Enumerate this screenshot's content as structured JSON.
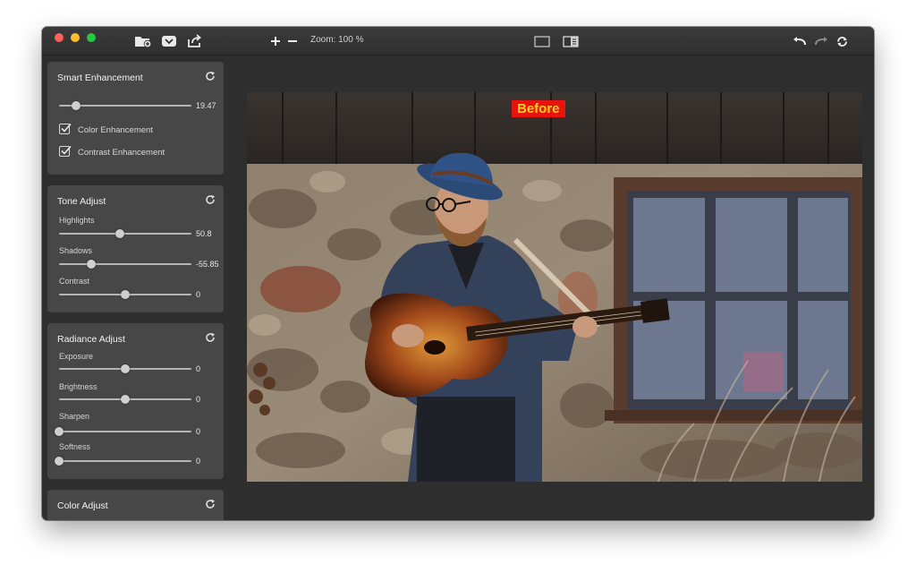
{
  "toolbar": {
    "zoom_label": "Zoom: 100 %",
    "icons": [
      "add-folder-icon",
      "import-icon",
      "export-icon",
      "zoom-in-icon",
      "zoom-out-icon",
      "single-view-icon",
      "split-view-icon",
      "undo-icon",
      "redo-icon",
      "refresh-icon"
    ]
  },
  "panels": {
    "smart": {
      "title": "Smart Enhancement",
      "value": "19.47",
      "level": 0.13,
      "checks": [
        {
          "label": "Color Enhancement",
          "checked": true
        },
        {
          "label": "Contrast Enhancement",
          "checked": true
        }
      ]
    },
    "tone": {
      "title": "Tone Adjust",
      "sliders": [
        {
          "label": "Highlights",
          "value": "50.8",
          "level": 0.46
        },
        {
          "label": "Shadows",
          "value": "-55.85",
          "level": 0.24
        },
        {
          "label": "Contrast",
          "value": "0",
          "level": 0.5
        }
      ]
    },
    "radiance": {
      "title": "Radiance Adjust",
      "sliders": [
        {
          "label": "Exposure",
          "value": "0",
          "level": 0.5
        },
        {
          "label": "Brightness",
          "value": "0",
          "level": 0.5
        },
        {
          "label": "Sharpen",
          "value": "0",
          "level": 0.0
        },
        {
          "label": "Softness",
          "value": "0",
          "level": 0.0
        }
      ]
    },
    "color": {
      "title": "Color Adjust"
    }
  },
  "preview": {
    "badge": "Before"
  },
  "colors": {
    "badge_bg": "#e8120e",
    "badge_text": "#ffd21e",
    "panel_bg": "#474747",
    "window_bg": "#2e2e2e"
  }
}
